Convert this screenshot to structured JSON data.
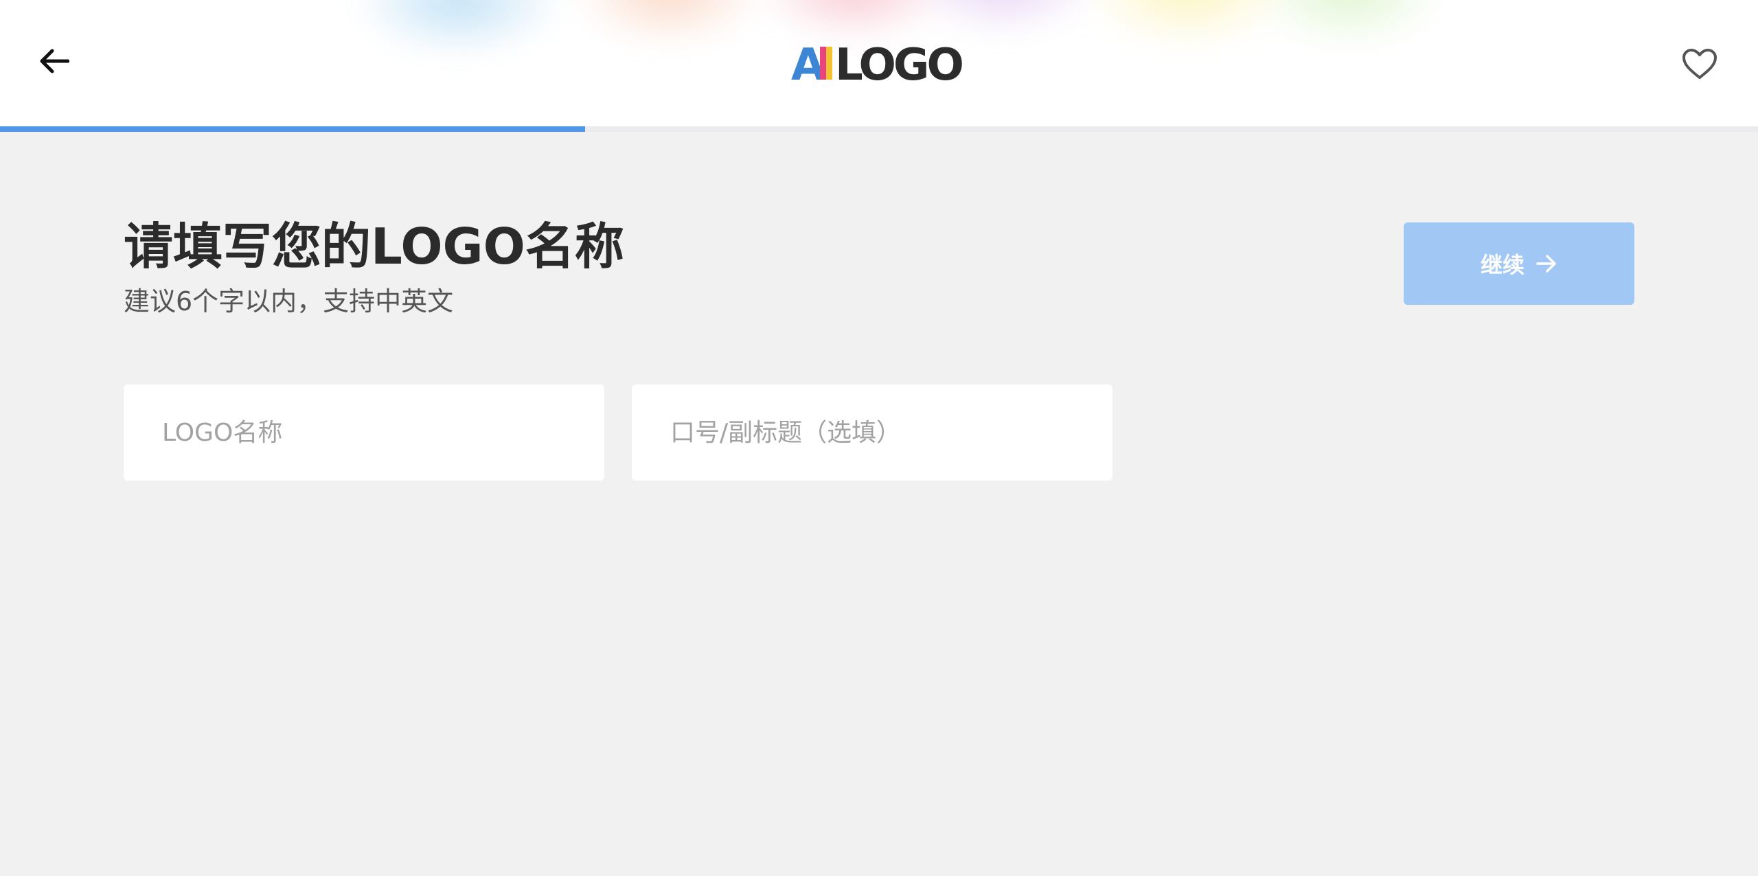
{
  "header": {
    "logo_text": {
      "part1": "AI",
      "part2": "LOGO"
    },
    "back_icon": "arrow-left-icon",
    "favorite_icon": "heart-icon"
  },
  "progress": {
    "value": 0.333
  },
  "main": {
    "title": "请填写您的LOGO名称",
    "subtitle": "建议6个字以内，支持中英文",
    "continue_label": "继续",
    "continue_icon": "arrow-right-icon",
    "name_field": {
      "value": "",
      "placeholder": "LOGO名称"
    },
    "slogan_field": {
      "value": "",
      "placeholder": "口号/副标题（选填）"
    }
  },
  "colors": {
    "accent": "#4f96e6",
    "button_disabled": "#a1c8f4",
    "logo_a": "#3d86d6",
    "logo_i_pink": "#e8457e",
    "logo_i_yellow": "#f2c230",
    "logo_dark": "#2c2c2c"
  }
}
